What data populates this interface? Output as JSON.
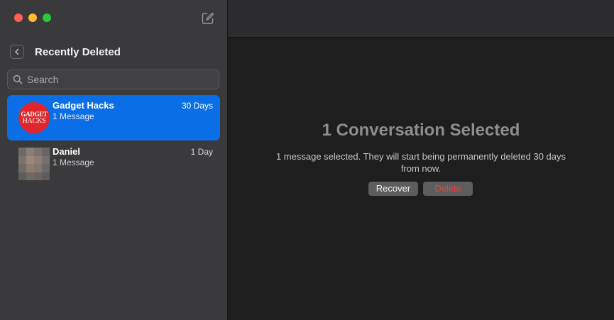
{
  "sidebar": {
    "header_title": "Recently Deleted",
    "search_placeholder": "Search",
    "conversations": [
      {
        "name": "Gadget Hacks",
        "subtitle": "1 Message",
        "time": "30 Days",
        "avatar_text_1": "GADGET",
        "avatar_text_2": "HACKS",
        "selected": true
      },
      {
        "name": "Daniel",
        "subtitle": "1 Message",
        "time": "1 Day",
        "selected": false
      }
    ]
  },
  "main": {
    "title": "1 Conversation Selected",
    "description": "1 message selected. They will start being permanently deleted 30 days from now.",
    "recover_label": "Recover",
    "delete_label": "Delete"
  },
  "colors": {
    "selection": "#0a6fe6",
    "delete_text": "#e2473f"
  },
  "icons": [
    "close-light",
    "minimize-light",
    "zoom-light",
    "compose-icon",
    "back-chevron-icon",
    "search-icon"
  ]
}
